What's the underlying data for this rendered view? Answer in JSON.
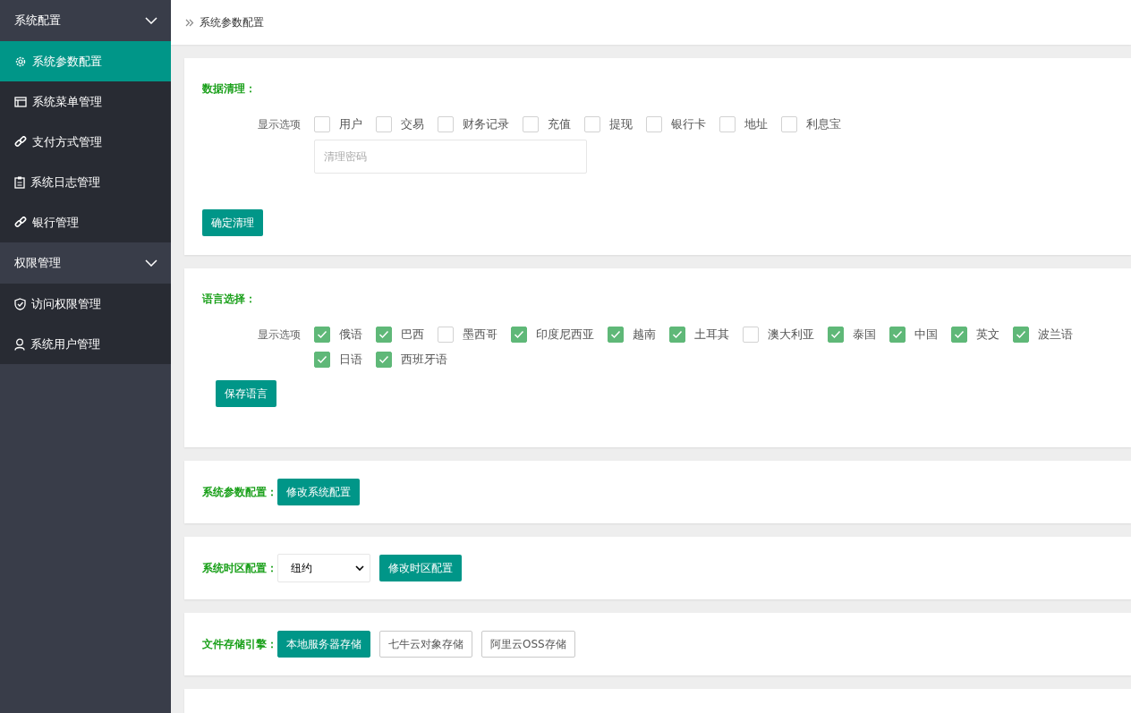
{
  "sidebar": {
    "groups": [
      {
        "title": "系统配置",
        "expanded": true,
        "items": [
          {
            "label": "系统参数配置",
            "selected": true
          },
          {
            "label": "系统菜单管理",
            "selected": false
          },
          {
            "label": "支付方式管理",
            "selected": false
          },
          {
            "label": "系统日志管理",
            "selected": false
          },
          {
            "label": "银行管理",
            "selected": false
          }
        ]
      },
      {
        "title": "权限管理",
        "expanded": true,
        "items": [
          {
            "label": "访问权限管理",
            "selected": false
          },
          {
            "label": "系统用户管理",
            "selected": false
          }
        ]
      }
    ]
  },
  "breadcrumb": "系统参数配置",
  "data_cleanup": {
    "title": "数据清理：",
    "options_label": "显示选项",
    "options": [
      {
        "label": "用户",
        "checked": false
      },
      {
        "label": "交易",
        "checked": false
      },
      {
        "label": "财务记录",
        "checked": false
      },
      {
        "label": "充值",
        "checked": false
      },
      {
        "label": "提现",
        "checked": false
      },
      {
        "label": "银行卡",
        "checked": false
      },
      {
        "label": "地址",
        "checked": false
      },
      {
        "label": "利息宝",
        "checked": false
      }
    ],
    "password": {
      "placeholder": "清理密码"
    },
    "button": "确定清理"
  },
  "language": {
    "title": "语言选择：",
    "options_label": "显示选项",
    "options": [
      {
        "label": "俄语",
        "checked": true
      },
      {
        "label": "巴西",
        "checked": true
      },
      {
        "label": "墨西哥",
        "checked": false
      },
      {
        "label": "印度尼西亚",
        "checked": true
      },
      {
        "label": "越南",
        "checked": true
      },
      {
        "label": "土耳其",
        "checked": true
      },
      {
        "label": "澳大利亚",
        "checked": false
      },
      {
        "label": "泰国",
        "checked": true
      },
      {
        "label": "中国",
        "checked": true
      },
      {
        "label": "英文",
        "checked": true
      },
      {
        "label": "波兰语",
        "checked": true
      },
      {
        "label": "日语",
        "checked": true
      },
      {
        "label": "西班牙语",
        "checked": true
      }
    ],
    "button": "保存语言"
  },
  "system_params": {
    "title": "系统参数配置：",
    "button": "修改系统配置"
  },
  "timezone": {
    "title": "系统时区配置：",
    "value": "纽约",
    "button": "修改时区配置"
  },
  "storage": {
    "title": "文件存储引擎：",
    "options": [
      {
        "label": "本地服务器存储",
        "selected": true
      },
      {
        "label": "七牛云对象存储",
        "selected": false
      },
      {
        "label": "阿里云OSS存储",
        "selected": false
      }
    ]
  }
}
